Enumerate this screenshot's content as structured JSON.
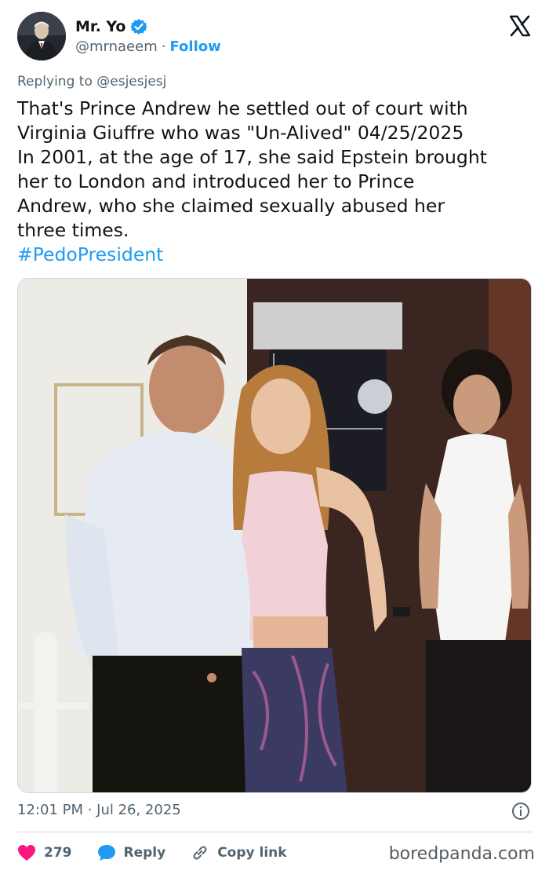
{
  "author": {
    "name": "Mr. Yo",
    "handle": "@mrnaeem",
    "separator": "·",
    "follow_label": "Follow",
    "verified": true
  },
  "replying_to": {
    "prefix": "Replying to",
    "handle": "@esjesjesj"
  },
  "tweet": {
    "lines": [
      "That's Prince Andrew he settled out of court with",
      "Virginia Giuffre who was \"Un-Alived\" 04/25/2025",
      "In 2001, at the age of 17, she said Epstein brought",
      "her to London and introduced her to Prince",
      "Andrew, who she claimed sexually abused her",
      "three times."
    ],
    "hashtag": "#PedoPresident"
  },
  "timestamp": "12:01 PM · Jul 26, 2025",
  "actions": {
    "likes": "279",
    "reply_label": "Reply",
    "copy_label": "Copy link"
  },
  "watermark": "boredpanda.com",
  "colors": {
    "accent": "#1d9bf0",
    "like": "#f91880",
    "text": "#0f1419",
    "muted": "#536471"
  },
  "icons": [
    "x-logo-icon",
    "verified-badge-icon",
    "info-icon",
    "heart-icon",
    "reply-bubble-icon",
    "link-icon"
  ]
}
